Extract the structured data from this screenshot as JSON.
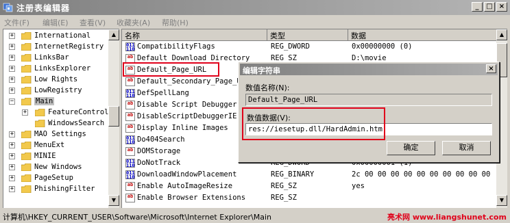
{
  "window": {
    "title": "注册表编辑器",
    "buttons": {
      "minimize": "_",
      "maximize": "□",
      "close": "×"
    }
  },
  "menu": [
    "文件(F)",
    "编辑(E)",
    "查看(V)",
    "收藏夹(A)",
    "帮助(H)"
  ],
  "tree": {
    "items": [
      {
        "label": "International",
        "expander": "+"
      },
      {
        "label": "InternetRegistry",
        "expander": "+"
      },
      {
        "label": "LinksBar",
        "expander": "+"
      },
      {
        "label": "LinksExplorer",
        "expander": "+"
      },
      {
        "label": "Low Rights",
        "expander": "+"
      },
      {
        "label": "LowRegistry",
        "expander": "+"
      },
      {
        "label": "Main",
        "expander": "−"
      },
      {
        "label": "FeatureControl",
        "expander": "+"
      },
      {
        "label": "WindowsSearch",
        "expander": ""
      },
      {
        "label": "MAO Settings",
        "expander": "+"
      },
      {
        "label": "MenuExt",
        "expander": "+"
      },
      {
        "label": "MINIE",
        "expander": "+"
      },
      {
        "label": "New Windows",
        "expander": "+"
      },
      {
        "label": "PageSetup",
        "expander": "+"
      },
      {
        "label": "PhishingFilter",
        "expander": "+"
      }
    ]
  },
  "list": {
    "columns": [
      "名称",
      "类型",
      "数据"
    ],
    "rows": [
      {
        "name": "CompatibilityFlags",
        "type": "REG_DWORD",
        "data": "0x00000000 (0)",
        "icon": "bin"
      },
      {
        "name": "Default Download Directory",
        "type": "REG_SZ",
        "data": "D:\\movie",
        "icon": "str"
      },
      {
        "name": "Default_Page_URL",
        "type": "",
        "data": "",
        "icon": "str"
      },
      {
        "name": "Default_Secondary_Page_URL",
        "type": "",
        "data": "",
        "icon": "str"
      },
      {
        "name": "DefSpellLang",
        "type": "",
        "data": "",
        "icon": "bin"
      },
      {
        "name": "Disable Script Debugger",
        "type": "",
        "data": "",
        "icon": "str"
      },
      {
        "name": "DisableScriptDebuggerIE",
        "type": "",
        "data": "",
        "icon": "str"
      },
      {
        "name": "Display Inline Images",
        "type": "",
        "data": "",
        "icon": "str"
      },
      {
        "name": "Do404Search",
        "type": "",
        "data": "",
        "icon": "bin"
      },
      {
        "name": "DOMStorage",
        "type": "",
        "data": "",
        "icon": "str"
      },
      {
        "name": "DoNotTrack",
        "type": "REG_DWORD",
        "data": "0x00000001 (1)",
        "icon": "bin"
      },
      {
        "name": "DownloadWindowPlacement",
        "type": "REG_BINARY",
        "data": "2c 00 00 00 00 00 00 00 00 00 00",
        "icon": "bin"
      },
      {
        "name": "Enable AutoImageResize",
        "type": "REG_SZ",
        "data": "yes",
        "icon": "str"
      },
      {
        "name": "Enable Browser Extensions",
        "type": "REG_SZ",
        "data": "",
        "icon": "str"
      }
    ]
  },
  "dialog": {
    "title": "编辑字符串",
    "close": "×",
    "name_label": "数值名称(N):",
    "name_value": "Default_Page_URL",
    "data_label": "数值数据(V):",
    "data_value": "res://iesetup.dll/HardAdmin.htm",
    "ok": "确定",
    "cancel": "取消"
  },
  "status": {
    "path": "计算机\\HKEY_CURRENT_USER\\Software\\Microsoft\\Internet Explorer\\Main",
    "watermark": "亮术网 www.liangshunet.com"
  },
  "colors": {
    "highlight": "#e0001a",
    "title_gradient": "#7f7f7f",
    "watermark": "#e0001a"
  }
}
